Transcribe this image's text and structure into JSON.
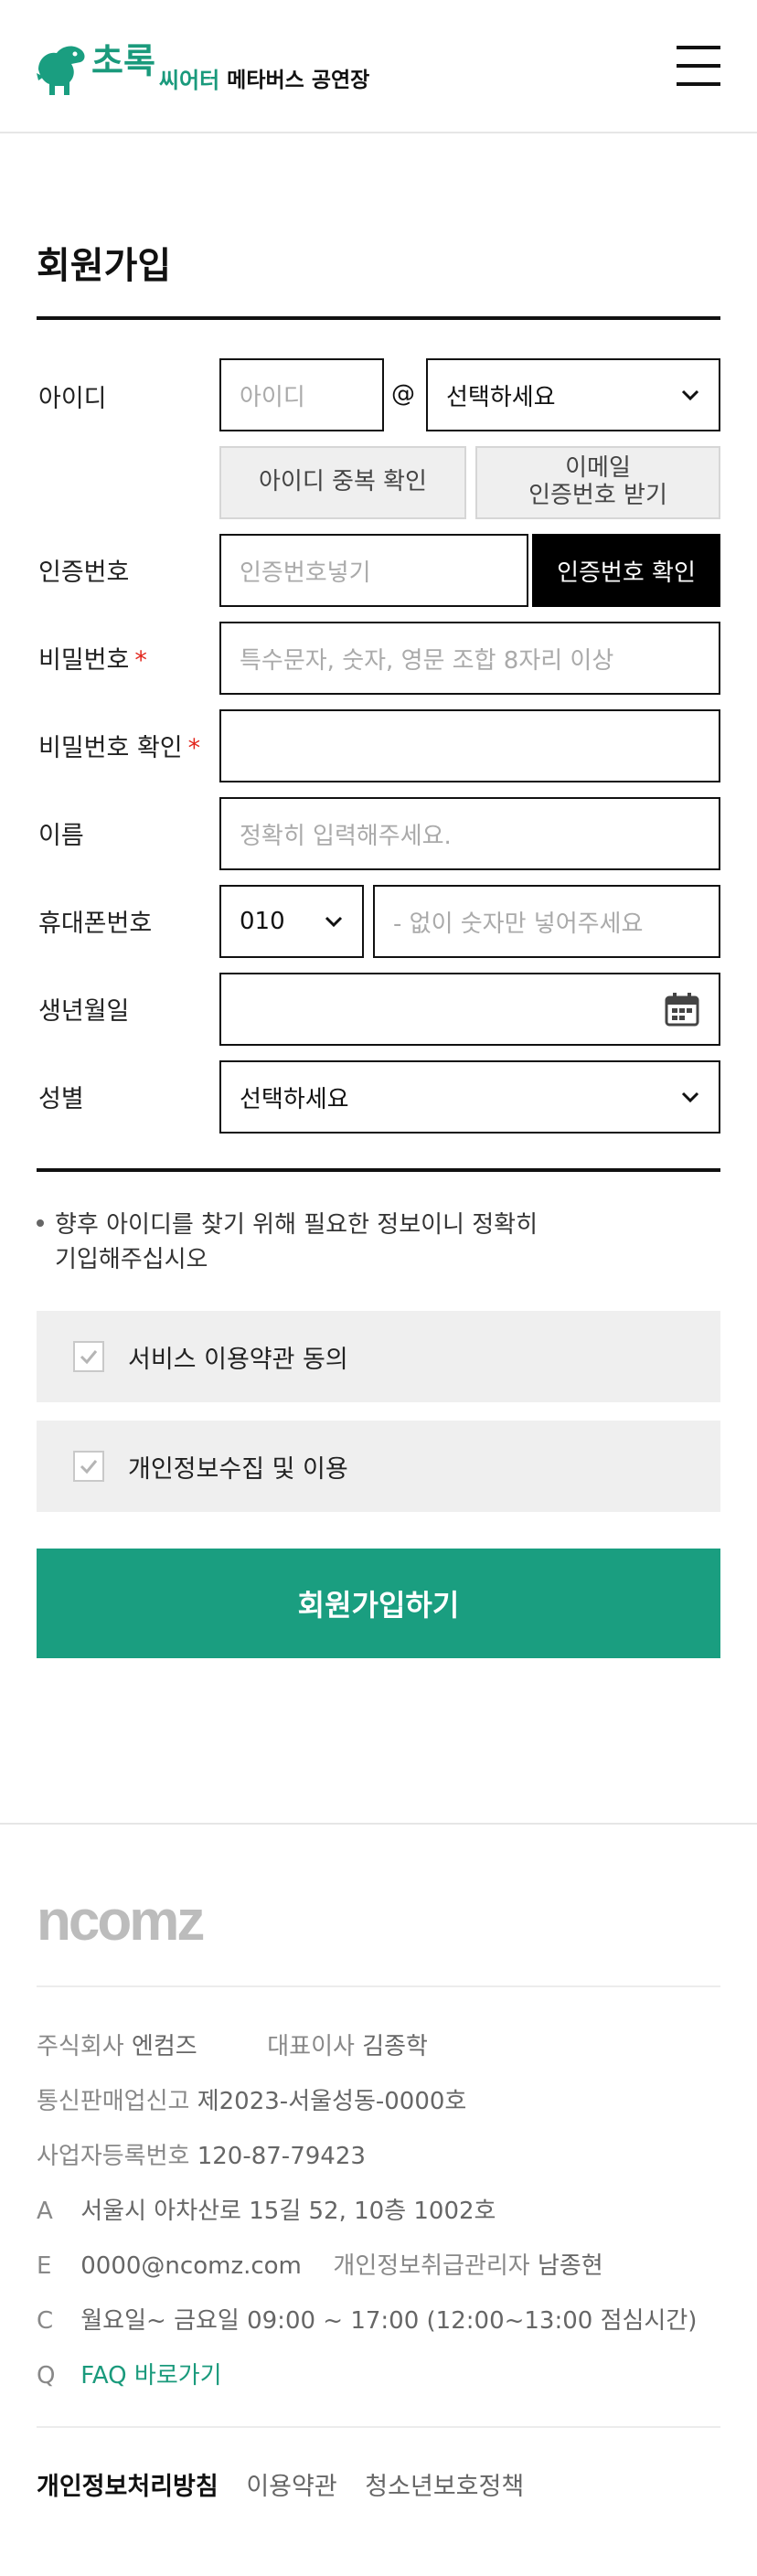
{
  "header": {
    "logo_main": "초록",
    "logo_sub1": "씨어터",
    "logo_sub2": "메타버스 공연장"
  },
  "page_title": "회원가입",
  "form": {
    "id": {
      "label": "아이디",
      "placeholder": "아이디",
      "at": "@",
      "domain_select": "선택하세요",
      "dup_check_button": "아이디 중복 확인",
      "email_code_button_line1": "이메일",
      "email_code_button_line2": "인증번호 받기"
    },
    "auth_code": {
      "label": "인증번호",
      "placeholder": "인증번호넣기",
      "confirm_button": "인증번호 확인"
    },
    "password": {
      "label": "비밀번호",
      "required_mark": "*",
      "placeholder": "특수문자, 숫자, 영문 조합 8자리 이상"
    },
    "password_confirm": {
      "label": "비밀번호 확인",
      "required_mark": "*",
      "placeholder": ""
    },
    "name": {
      "label": "이름",
      "placeholder": "정확히 입력해주세요."
    },
    "phone": {
      "label": "휴대폰번호",
      "prefix_select": "010",
      "placeholder": "- 없이 숫자만 넣어주세요"
    },
    "birthdate": {
      "label": "생년월일",
      "value": ""
    },
    "gender": {
      "label": "성별",
      "select": "선택하세요"
    }
  },
  "notice": {
    "line1": "향후 아이디를 찾기 위해 필요한 정보이니 정확히",
    "line2": "기입해주십시오"
  },
  "agreements": [
    {
      "label": "서비스 이용약관 동의",
      "checked": true
    },
    {
      "label": "개인정보수집 및 이용",
      "checked": true
    }
  ],
  "submit_label": "회원가입하기",
  "footer": {
    "logo_text": "ncomz",
    "company_label": "주식회사",
    "company_name": "엔컴즈",
    "ceo_label": "대표이사",
    "ceo_name": "김종학",
    "mail_order_label": "통신판매업신고",
    "mail_order_value": "제2023-서울성동-0000호",
    "biz_reg_label": "사업자등록번호",
    "biz_reg_value": "120-87-79423",
    "address_key": "A",
    "address": "서울시 아차산로 15길 52, 10층 1002호",
    "email_key": "E",
    "email": "0000@ncomz.com",
    "privacy_officer_label": "개인정보취급관리자",
    "privacy_officer_name": "남종현",
    "hours_key": "C",
    "hours": "월요일~ 금요일 09:00 ~ 17:00 (12:00~13:00 점심시간)",
    "faq_key": "Q",
    "faq_link": "FAQ 바로가기",
    "links": [
      "개인정보처리방침",
      "이용약관",
      "청소년보호정책"
    ]
  },
  "colors": {
    "brand_green": "#1a9e80",
    "required_red": "#e2261c",
    "black_button": "#000000"
  }
}
